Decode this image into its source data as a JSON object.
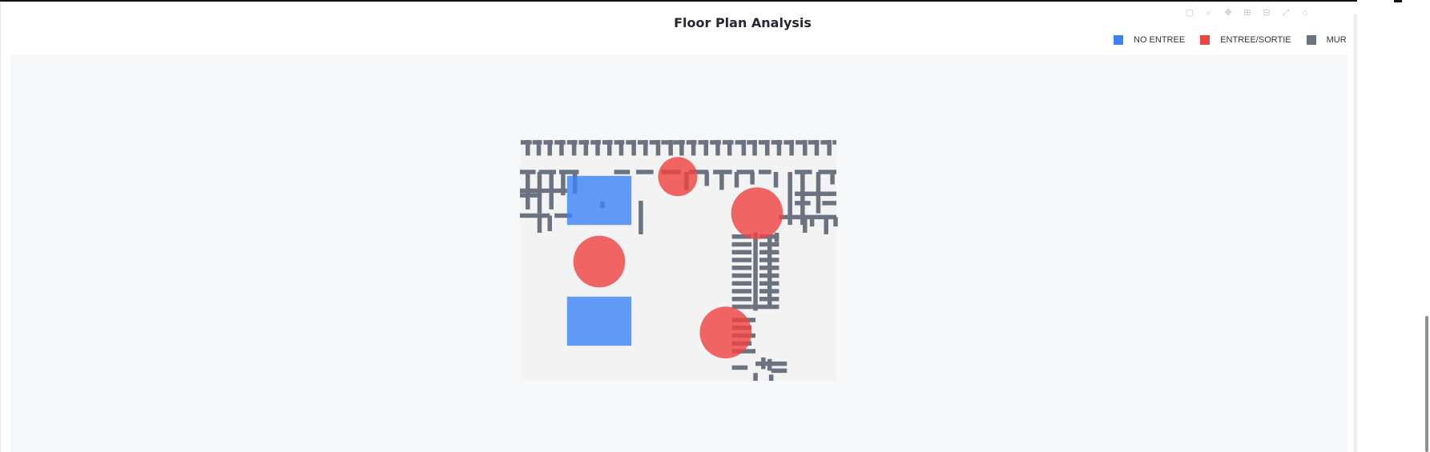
{
  "chart_data": {
    "type": "scatter",
    "title": "Floor Plan Analysis",
    "legend_position": "top-right",
    "grid": false,
    "series": [
      {
        "name": "NO ENTREE",
        "color": "#3b82f6",
        "shape": "square",
        "rects": [
          {
            "x0": 60,
            "x1": 142,
            "y0": 200,
            "y1": 263
          },
          {
            "x0": 60,
            "x1": 142,
            "y0": 45,
            "y1": 108
          }
        ]
      },
      {
        "name": "ENTREE/SORTIE",
        "color": "#ef4444",
        "shape": "circle",
        "circles": [
          {
            "cx": 201,
            "cy": 262,
            "r": 25
          },
          {
            "cx": 302,
            "cy": 215,
            "r": 33
          },
          {
            "cx": 101,
            "cy": 153,
            "r": 33
          },
          {
            "cx": 262,
            "cy": 62,
            "r": 33
          }
        ]
      },
      {
        "name": "MUR",
        "color": "#6b7280",
        "shape": "wall",
        "segments": [
          [
            1,
            306,
            15,
            306
          ],
          [
            16,
            306,
            28,
            306
          ],
          [
            30,
            306,
            42,
            306
          ],
          [
            44,
            306,
            58,
            306
          ],
          [
            60,
            306,
            73,
            306
          ],
          [
            75,
            306,
            88,
            306
          ],
          [
            90,
            306,
            103,
            306
          ],
          [
            105,
            306,
            118,
            306
          ],
          [
            120,
            306,
            133,
            306
          ],
          [
            135,
            306,
            148,
            306
          ],
          [
            150,
            306,
            163,
            306
          ],
          [
            165,
            306,
            178,
            306
          ],
          [
            180,
            306,
            193,
            306
          ],
          [
            195,
            306,
            210,
            306
          ],
          [
            212,
            306,
            225,
            306
          ],
          [
            227,
            306,
            240,
            306
          ],
          [
            242,
            306,
            256,
            306
          ],
          [
            258,
            306,
            272,
            306
          ],
          [
            274,
            306,
            287,
            306
          ],
          [
            289,
            306,
            302,
            306
          ],
          [
            304,
            306,
            318,
            306
          ],
          [
            320,
            306,
            334,
            306
          ],
          [
            336,
            306,
            349,
            306
          ],
          [
            351,
            306,
            365,
            306
          ],
          [
            367,
            306,
            381,
            306
          ],
          [
            383,
            306,
            396,
            306
          ],
          [
            398,
            306,
            403,
            306
          ],
          [
            10,
            309,
            10,
            289
          ],
          [
            24,
            309,
            24,
            289
          ],
          [
            38,
            309,
            38,
            289
          ],
          [
            53,
            309,
            53,
            289
          ],
          [
            69,
            309,
            69,
            289
          ],
          [
            84,
            309,
            84,
            289
          ],
          [
            99,
            309,
            99,
            289
          ],
          [
            114,
            309,
            114,
            289
          ],
          [
            129,
            309,
            129,
            289
          ],
          [
            145,
            309,
            145,
            289
          ],
          [
            160,
            309,
            160,
            289
          ],
          [
            176,
            309,
            176,
            289
          ],
          [
            192,
            309,
            192,
            289
          ],
          [
            206,
            309,
            206,
            289
          ],
          [
            221,
            309,
            221,
            289
          ],
          [
            237,
            309,
            237,
            289
          ],
          [
            252,
            309,
            252,
            289
          ],
          [
            267,
            309,
            267,
            289
          ],
          [
            285,
            309,
            285,
            289
          ],
          [
            299,
            309,
            299,
            289
          ],
          [
            315,
            309,
            315,
            289
          ],
          [
            330,
            309,
            330,
            289
          ],
          [
            346,
            309,
            346,
            289
          ],
          [
            363,
            309,
            363,
            289
          ],
          [
            378,
            309,
            378,
            289
          ],
          [
            394,
            309,
            394,
            289
          ],
          [
            0,
            268,
            20,
            268
          ],
          [
            24,
            268,
            46,
            268
          ],
          [
            50,
            268,
            75,
            268
          ],
          [
            120,
            268,
            140,
            268
          ],
          [
            148,
            268,
            170,
            268
          ],
          [
            180,
            268,
            205,
            268
          ],
          [
            215,
            268,
            240,
            268
          ],
          [
            246,
            268,
            270,
            268
          ],
          [
            276,
            268,
            298,
            268
          ],
          [
            304,
            268,
            320,
            268
          ],
          [
            350,
            268,
            372,
            268
          ],
          [
            380,
            268,
            403,
            268
          ],
          [
            10,
            268,
            10,
            220
          ],
          [
            25,
            268,
            25,
            215
          ],
          [
            40,
            268,
            40,
            220
          ],
          [
            55,
            268,
            55,
            238
          ],
          [
            70,
            268,
            70,
            240
          ],
          [
            212,
            268,
            212,
            245
          ],
          [
            238,
            268,
            238,
            250
          ],
          [
            257,
            268,
            257,
            245
          ],
          [
            276,
            268,
            276,
            248
          ],
          [
            296,
            268,
            296,
            252
          ],
          [
            326,
            268,
            326,
            248
          ],
          [
            344,
            268,
            344,
            200
          ],
          [
            360,
            268,
            360,
            200
          ],
          [
            380,
            268,
            380,
            215
          ],
          [
            398,
            268,
            398,
            252
          ],
          [
            0,
            244,
            60,
            244
          ],
          [
            0,
            238,
            25,
            238
          ],
          [
            350,
            240,
            403,
            240
          ],
          [
            350,
            228,
            370,
            228
          ],
          [
            385,
            228,
            403,
            228
          ],
          [
            0,
            212,
            38,
            212
          ],
          [
            44,
            212,
            66,
            212
          ],
          [
            330,
            210,
            403,
            210
          ],
          [
            372,
            210,
            372,
            198
          ],
          [
            38,
            212,
            38,
            192
          ],
          [
            25,
            210,
            25,
            190
          ],
          [
            363,
            210,
            363,
            190
          ],
          [
            390,
            210,
            390,
            188
          ],
          [
            402,
            210,
            402,
            198
          ],
          [
            154,
            231,
            154,
            188
          ],
          [
            105,
            230,
            105,
            222
          ],
          [
            270,
            185,
            295,
            185
          ],
          [
            270,
            175,
            295,
            175
          ],
          [
            270,
            165,
            295,
            165
          ],
          [
            270,
            155,
            295,
            155
          ],
          [
            270,
            145,
            295,
            145
          ],
          [
            270,
            135,
            295,
            135
          ],
          [
            270,
            125,
            295,
            125
          ],
          [
            270,
            115,
            295,
            115
          ],
          [
            270,
            105,
            295,
            105
          ],
          [
            270,
            95,
            295,
            95
          ],
          [
            305,
            185,
            330,
            185
          ],
          [
            305,
            175,
            330,
            175
          ],
          [
            305,
            165,
            330,
            165
          ],
          [
            305,
            155,
            330,
            155
          ],
          [
            305,
            145,
            330,
            145
          ],
          [
            305,
            135,
            330,
            135
          ],
          [
            305,
            125,
            330,
            125
          ],
          [
            305,
            115,
            330,
            115
          ],
          [
            305,
            105,
            330,
            105
          ],
          [
            295,
            95,
            330,
            95
          ],
          [
            300,
            190,
            300,
            90
          ],
          [
            318,
            187,
            318,
            95
          ],
          [
            327,
            190,
            327,
            178
          ],
          [
            270,
            78,
            300,
            78
          ],
          [
            270,
            68,
            295,
            68
          ],
          [
            270,
            58,
            300,
            58
          ],
          [
            270,
            48,
            295,
            48
          ],
          [
            270,
            38,
            300,
            38
          ],
          [
            270,
            17,
            290,
            17
          ],
          [
            300,
            22,
            340,
            22
          ],
          [
            320,
            13,
            340,
            13
          ],
          [
            318,
            28,
            318,
            13
          ],
          [
            310,
            30,
            310,
            15
          ],
          [
            300,
            10,
            300,
            0
          ],
          [
            320,
            8,
            320,
            0
          ]
        ]
      }
    ],
    "xlim": [
      0,
      403
    ],
    "ylim": [
      0,
      309
    ]
  }
}
